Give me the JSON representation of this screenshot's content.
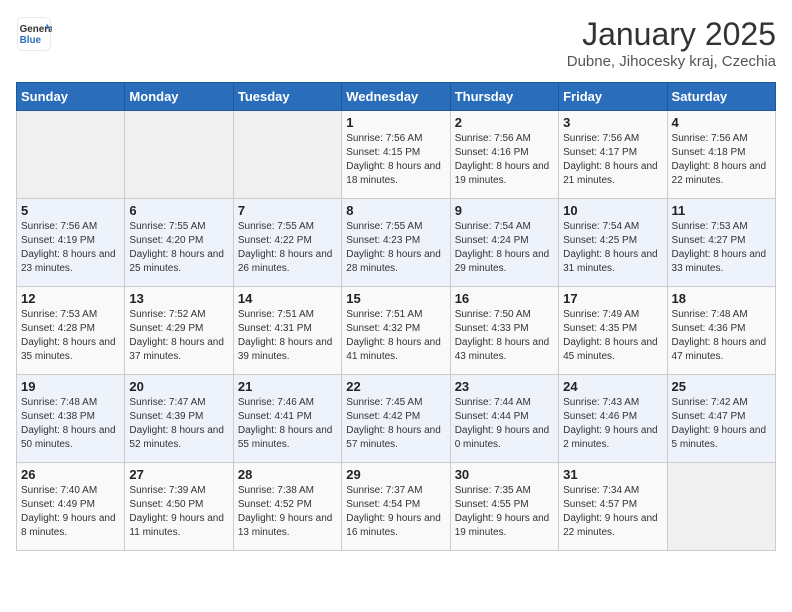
{
  "header": {
    "logo_general": "General",
    "logo_blue": "Blue",
    "title": "January 2025",
    "subtitle": "Dubne, Jihocesky kraj, Czechia"
  },
  "weekdays": [
    "Sunday",
    "Monday",
    "Tuesday",
    "Wednesday",
    "Thursday",
    "Friday",
    "Saturday"
  ],
  "weeks": [
    [
      {
        "day": "",
        "info": ""
      },
      {
        "day": "",
        "info": ""
      },
      {
        "day": "",
        "info": ""
      },
      {
        "day": "1",
        "info": "Sunrise: 7:56 AM\nSunset: 4:15 PM\nDaylight: 8 hours\nand 18 minutes."
      },
      {
        "day": "2",
        "info": "Sunrise: 7:56 AM\nSunset: 4:16 PM\nDaylight: 8 hours\nand 19 minutes."
      },
      {
        "day": "3",
        "info": "Sunrise: 7:56 AM\nSunset: 4:17 PM\nDaylight: 8 hours\nand 21 minutes."
      },
      {
        "day": "4",
        "info": "Sunrise: 7:56 AM\nSunset: 4:18 PM\nDaylight: 8 hours\nand 22 minutes."
      }
    ],
    [
      {
        "day": "5",
        "info": "Sunrise: 7:56 AM\nSunset: 4:19 PM\nDaylight: 8 hours\nand 23 minutes."
      },
      {
        "day": "6",
        "info": "Sunrise: 7:55 AM\nSunset: 4:20 PM\nDaylight: 8 hours\nand 25 minutes."
      },
      {
        "day": "7",
        "info": "Sunrise: 7:55 AM\nSunset: 4:22 PM\nDaylight: 8 hours\nand 26 minutes."
      },
      {
        "day": "8",
        "info": "Sunrise: 7:55 AM\nSunset: 4:23 PM\nDaylight: 8 hours\nand 28 minutes."
      },
      {
        "day": "9",
        "info": "Sunrise: 7:54 AM\nSunset: 4:24 PM\nDaylight: 8 hours\nand 29 minutes."
      },
      {
        "day": "10",
        "info": "Sunrise: 7:54 AM\nSunset: 4:25 PM\nDaylight: 8 hours\nand 31 minutes."
      },
      {
        "day": "11",
        "info": "Sunrise: 7:53 AM\nSunset: 4:27 PM\nDaylight: 8 hours\nand 33 minutes."
      }
    ],
    [
      {
        "day": "12",
        "info": "Sunrise: 7:53 AM\nSunset: 4:28 PM\nDaylight: 8 hours\nand 35 minutes."
      },
      {
        "day": "13",
        "info": "Sunrise: 7:52 AM\nSunset: 4:29 PM\nDaylight: 8 hours\nand 37 minutes."
      },
      {
        "day": "14",
        "info": "Sunrise: 7:51 AM\nSunset: 4:31 PM\nDaylight: 8 hours\nand 39 minutes."
      },
      {
        "day": "15",
        "info": "Sunrise: 7:51 AM\nSunset: 4:32 PM\nDaylight: 8 hours\nand 41 minutes."
      },
      {
        "day": "16",
        "info": "Sunrise: 7:50 AM\nSunset: 4:33 PM\nDaylight: 8 hours\nand 43 minutes."
      },
      {
        "day": "17",
        "info": "Sunrise: 7:49 AM\nSunset: 4:35 PM\nDaylight: 8 hours\nand 45 minutes."
      },
      {
        "day": "18",
        "info": "Sunrise: 7:48 AM\nSunset: 4:36 PM\nDaylight: 8 hours\nand 47 minutes."
      }
    ],
    [
      {
        "day": "19",
        "info": "Sunrise: 7:48 AM\nSunset: 4:38 PM\nDaylight: 8 hours\nand 50 minutes."
      },
      {
        "day": "20",
        "info": "Sunrise: 7:47 AM\nSunset: 4:39 PM\nDaylight: 8 hours\nand 52 minutes."
      },
      {
        "day": "21",
        "info": "Sunrise: 7:46 AM\nSunset: 4:41 PM\nDaylight: 8 hours\nand 55 minutes."
      },
      {
        "day": "22",
        "info": "Sunrise: 7:45 AM\nSunset: 4:42 PM\nDaylight: 8 hours\nand 57 minutes."
      },
      {
        "day": "23",
        "info": "Sunrise: 7:44 AM\nSunset: 4:44 PM\nDaylight: 9 hours\nand 0 minutes."
      },
      {
        "day": "24",
        "info": "Sunrise: 7:43 AM\nSunset: 4:46 PM\nDaylight: 9 hours\nand 2 minutes."
      },
      {
        "day": "25",
        "info": "Sunrise: 7:42 AM\nSunset: 4:47 PM\nDaylight: 9 hours\nand 5 minutes."
      }
    ],
    [
      {
        "day": "26",
        "info": "Sunrise: 7:40 AM\nSunset: 4:49 PM\nDaylight: 9 hours\nand 8 minutes."
      },
      {
        "day": "27",
        "info": "Sunrise: 7:39 AM\nSunset: 4:50 PM\nDaylight: 9 hours\nand 11 minutes."
      },
      {
        "day": "28",
        "info": "Sunrise: 7:38 AM\nSunset: 4:52 PM\nDaylight: 9 hours\nand 13 minutes."
      },
      {
        "day": "29",
        "info": "Sunrise: 7:37 AM\nSunset: 4:54 PM\nDaylight: 9 hours\nand 16 minutes."
      },
      {
        "day": "30",
        "info": "Sunrise: 7:35 AM\nSunset: 4:55 PM\nDaylight: 9 hours\nand 19 minutes."
      },
      {
        "day": "31",
        "info": "Sunrise: 7:34 AM\nSunset: 4:57 PM\nDaylight: 9 hours\nand 22 minutes."
      },
      {
        "day": "",
        "info": ""
      }
    ]
  ]
}
